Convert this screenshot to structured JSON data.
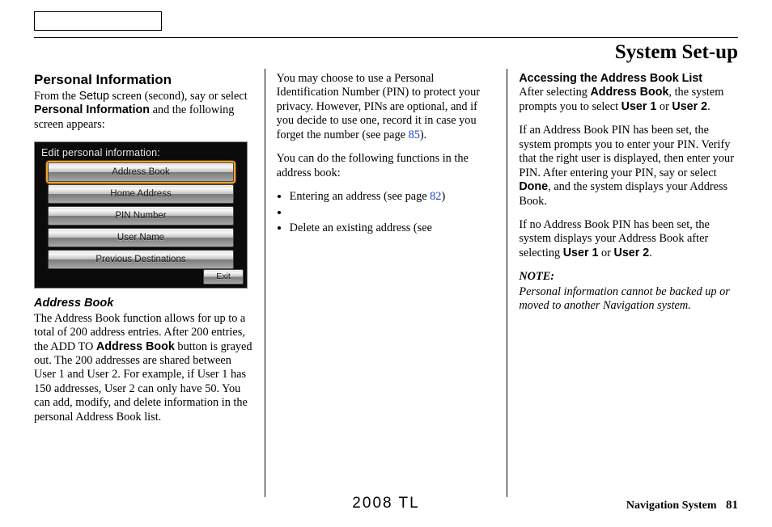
{
  "header": {
    "title": "System Set-up"
  },
  "col1": {
    "h2": "Personal Information",
    "intro_a": "From the ",
    "intro_setup": "Setup",
    "intro_b": " screen (second), say or select ",
    "intro_pi": "Personal Information",
    "intro_c": " and the following screen appears:",
    "navshot": {
      "title": "Edit personal information:",
      "btn1": "Address Book",
      "btn2": "Home Address",
      "btn3": "PIN Number",
      "btn4": "User Name",
      "btn5": "Previous Destinations",
      "exit": "Exit"
    },
    "hsub": "Address Book",
    "ab_a": "The Address Book function allows for up to a total of 200 address entries. After 200 entries, the ADD TO ",
    "ab_bold": "Address Book",
    "ab_b": " button is grayed out. The 200 addresses are shared between User 1 and User 2. For example, if User 1 has 150 addresses, User 2 can only have 50. You can add, modify, and delete information in the personal Address Book list."
  },
  "col2": {
    "p1_a": "You may choose to use a Personal Identification Number (PIN) to protect your privacy. However, PINs are optional, and if you decide to use one, record it in case you forget the number (see page ",
    "p1_link": "85",
    "p1_b": ").",
    "p2": "You can do the following functions in the address book:",
    "li1_a": "Entering an address (see page ",
    "li1_link": "82",
    "li1_b": ")",
    "li2": "",
    "li3": "Delete an existing address (see"
  },
  "col3": {
    "h": "Accessing the Address Book List",
    "p1_a": "After selecting ",
    "p1_ab": "Address Book",
    "p1_b": ", the system prompts you to select ",
    "p1_u1": "User 1",
    "p1_c": " or ",
    "p1_u2": "User 2",
    "p1_d": ".",
    "p2_a": "If an Address Book PIN has been set, the system prompts you to enter your PIN. Verify that the right user is displayed, then enter your PIN. After entering your PIN, say or select ",
    "p2_done": "Done",
    "p2_b": ", and the system displays your Address Book.",
    "p3_a": "If no Address Book PIN has been set, the system displays your Address Book after selecting ",
    "p3_u1": "User 1",
    "p3_or": " or ",
    "p3_u2": "User 2",
    "p3_b": ".",
    "note_h": "NOTE:",
    "note_b": "Personal information cannot be backed up or moved to another Navigation system."
  },
  "footer": {
    "center": "2008  TL",
    "rlabel": "Navigation System",
    "pageno": "81"
  }
}
